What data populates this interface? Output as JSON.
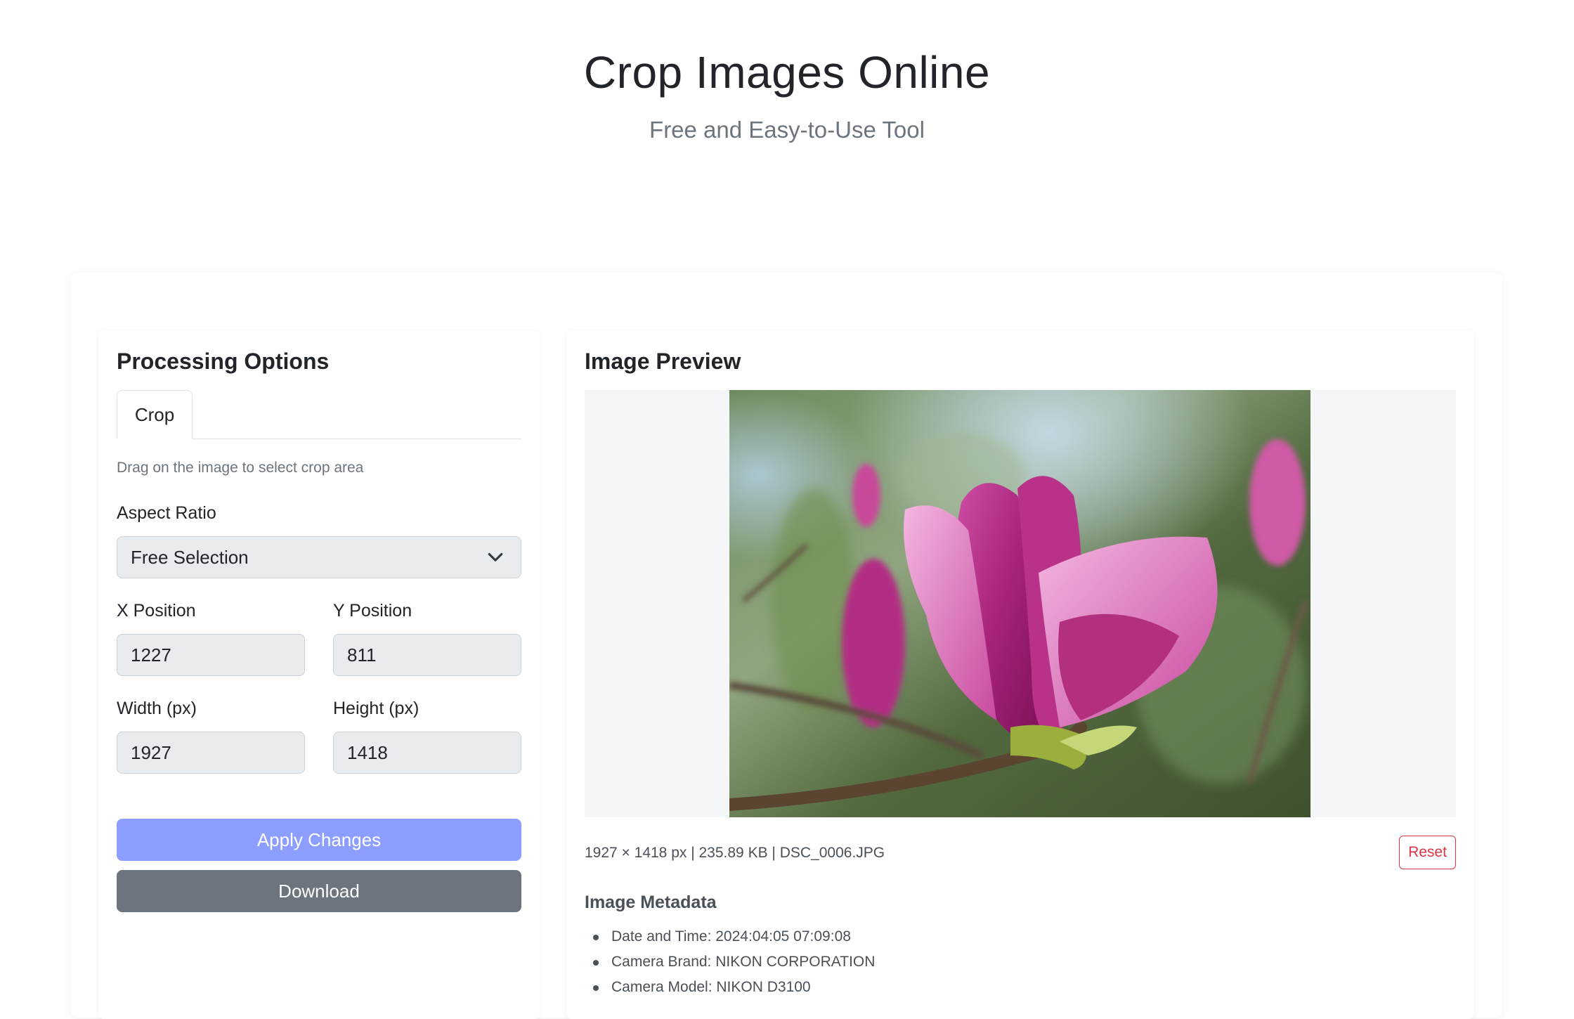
{
  "header": {
    "title": "Crop Images Online",
    "subtitle": "Free and Easy-to-Use Tool"
  },
  "options": {
    "heading": "Processing Options",
    "tabs": [
      {
        "label": "Crop",
        "active": true
      }
    ],
    "help_text": "Drag on the image to select crop area",
    "aspect_ratio": {
      "label": "Aspect Ratio",
      "value": "Free Selection"
    },
    "x_position": {
      "label": "X Position",
      "value": "1227"
    },
    "y_position": {
      "label": "Y Position",
      "value": "811"
    },
    "width": {
      "label": "Width (px)",
      "value": "1927"
    },
    "height": {
      "label": "Height (px)",
      "value": "1418"
    },
    "apply_label": "Apply Changes",
    "download_label": "Download"
  },
  "preview": {
    "heading": "Image Preview",
    "image_alt": "magenta magnolia flower photo",
    "file_info": "1927 × 1418 px | 235.89 KB | DSC_0006.JPG",
    "reset_label": "Reset",
    "metadata_heading": "Image Metadata",
    "metadata": [
      "Date and Time: 2024:04:05 07:09:08",
      "Camera Brand: NIKON CORPORATION",
      "Camera Model: NIKON D3100"
    ]
  },
  "colors": {
    "accent": "#8c9eff",
    "secondary": "#6c757d",
    "danger": "#dc3545"
  }
}
